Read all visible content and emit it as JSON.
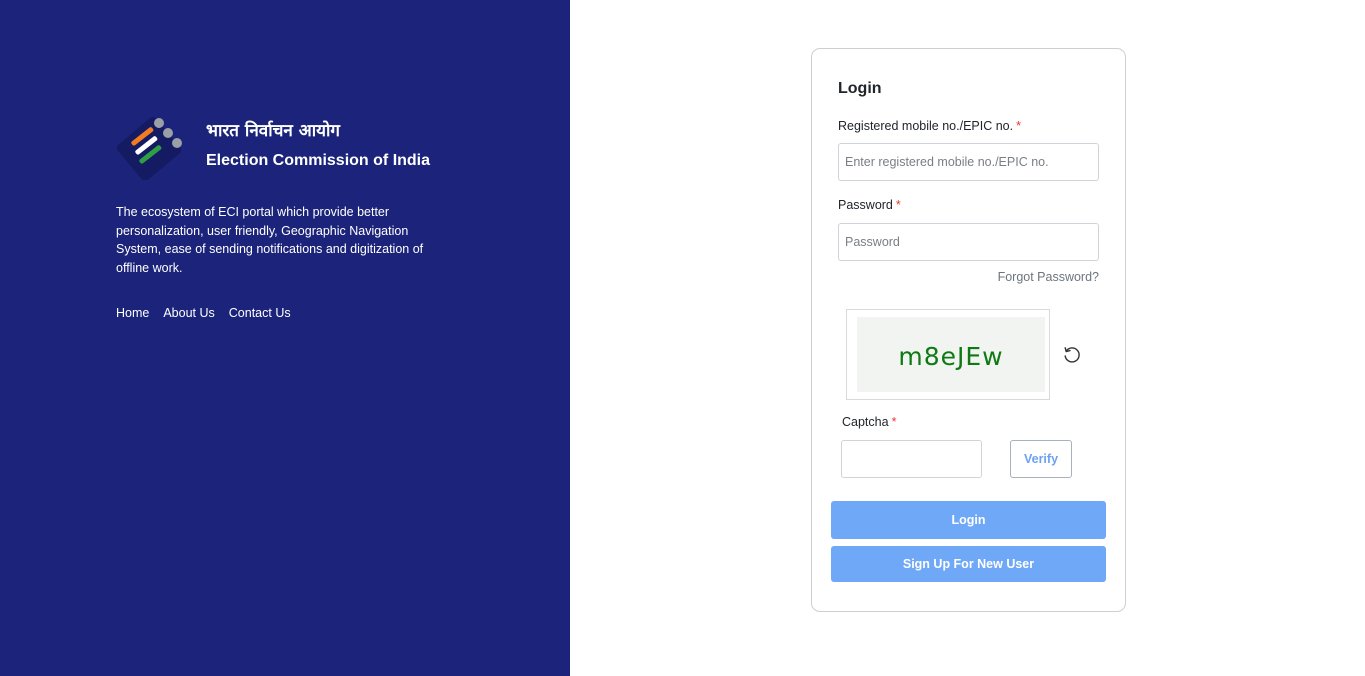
{
  "brand": {
    "hindi_name": "भारत निर्वाचन आयोग",
    "english_name": "Election Commission of India",
    "logo_icon": "eci-logo-icon",
    "logo_colors": [
      "#f47c20",
      "#ffffff",
      "#2ea043",
      "#9aa0a6"
    ]
  },
  "description": "The ecosystem of ECI portal which provide better personalization, user friendly, Geographic Navigation System, ease of sending notifications and digitization of offline work.",
  "nav": {
    "links": [
      {
        "label": "Home"
      },
      {
        "label": "About Us"
      },
      {
        "label": "Contact Us"
      }
    ]
  },
  "login_form": {
    "title": "Login",
    "mobile_label": "Registered mobile no./EPIC no.",
    "mobile_placeholder": "Enter registered mobile no./EPIC no.",
    "mobile_value": "",
    "password_label": "Password",
    "password_placeholder": "Password",
    "password_value": "",
    "required_mark": "*",
    "forgot_password": "Forgot Password?",
    "captcha_text": "m8eJEw",
    "refresh_icon": "refresh-icon",
    "captcha_label": "Captcha",
    "captcha_value": "",
    "verify_label": "Verify",
    "login_label": "Login",
    "signup_label": "Sign Up For New User"
  },
  "colors": {
    "panel_bg": "#1b247a",
    "primary_button": "#6fa8f7",
    "required": "#e53935",
    "captcha_text": "#0f7a14"
  }
}
